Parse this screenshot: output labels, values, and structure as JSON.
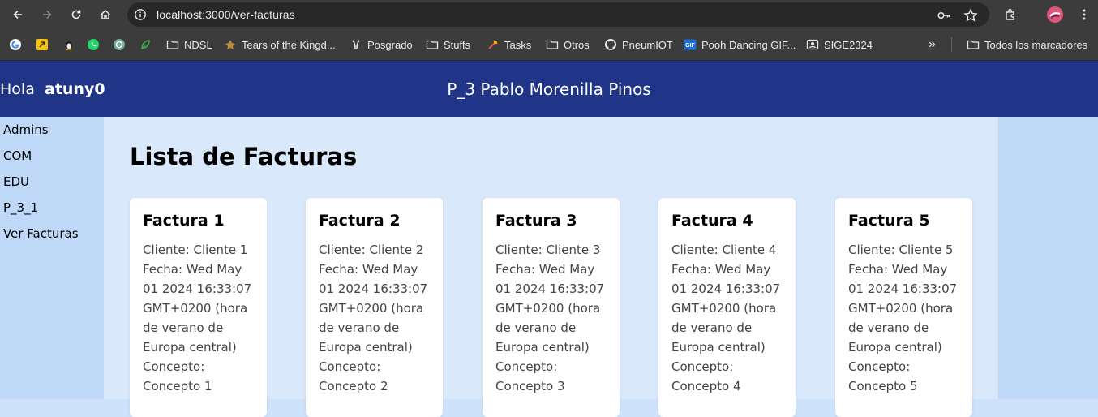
{
  "browser": {
    "url": "localhost:3000/ver-facturas",
    "nav_icons": [
      "back-icon",
      "forward-icon",
      "reload-icon",
      "home-icon"
    ],
    "bookmarks": [
      {
        "label": "",
        "icon": "google-icon"
      },
      {
        "label": "",
        "icon": "bookmark-app-icon"
      },
      {
        "label": "",
        "icon": "linux-penguin-icon"
      },
      {
        "label": "",
        "icon": "whatsapp-icon"
      },
      {
        "label": "",
        "icon": "chatgpt-icon"
      },
      {
        "label": "",
        "icon": "leaf-icon"
      },
      {
        "label": "NDSL",
        "icon": "folder-icon"
      },
      {
        "label": "Tears of the Kingd...",
        "icon": "site-favicon-icon"
      },
      {
        "label": "Posgrado",
        "icon": "site-favicon-icon"
      },
      {
        "label": "Stuffs",
        "icon": "folder-icon"
      },
      {
        "label": "Tasks",
        "icon": "site-favicon-icon"
      },
      {
        "label": "Otros",
        "icon": "folder-icon"
      },
      {
        "label": "PneumIOT",
        "icon": "github-icon"
      },
      {
        "label": "Pooh Dancing GIF...",
        "icon": "gif-icon"
      },
      {
        "label": "SIGE2324",
        "icon": "site-favicon-icon"
      }
    ],
    "all_bookmarks_label": "Todos los marcadores",
    "overflow_label": "»"
  },
  "header": {
    "greeting": "Hola",
    "username": "atuny0",
    "title": "P_3 Pablo Morenilla Pinos"
  },
  "sidebar": {
    "items": [
      "Admins",
      "COM",
      "EDU",
      "P_3_1",
      "Ver Facturas"
    ]
  },
  "main": {
    "heading": "Lista de Facturas",
    "invoices": [
      {
        "title": "Factura 1",
        "cliente": "Cliente: Cliente 1",
        "fecha": "Fecha: Wed May 01 2024 16:33:07 GMT+0200 (hora de verano de Europa central)",
        "concepto": "Concepto: Concepto 1"
      },
      {
        "title": "Factura 2",
        "cliente": "Cliente: Cliente 2",
        "fecha": "Fecha: Wed May 01 2024 16:33:07 GMT+0200 (hora de verano de Europa central)",
        "concepto": "Concepto: Concepto 2"
      },
      {
        "title": "Factura 3",
        "cliente": "Cliente: Cliente 3",
        "fecha": "Fecha: Wed May 01 2024 16:33:07 GMT+0200 (hora de verano de Europa central)",
        "concepto": "Concepto: Concepto 3"
      },
      {
        "title": "Factura 4",
        "cliente": "Cliente: Cliente 4",
        "fecha": "Fecha: Wed May 01 2024 16:33:07 GMT+0200 (hora de verano de Europa central)",
        "concepto": "Concepto: Concepto 4"
      },
      {
        "title": "Factura 5",
        "cliente": "Cliente: Cliente 5",
        "fecha": "Fecha: Wed May 01 2024 16:33:07 GMT+0200 (hora de verano de Europa central)",
        "concepto": "Concepto: Concepto 5"
      }
    ]
  },
  "colors": {
    "header_bg": "#203588",
    "sidebar_bg": "#bfd8f7",
    "main_bg": "#dae8fb",
    "card_bg": "#ffffff",
    "chrome_bg": "#3c3c3c"
  }
}
